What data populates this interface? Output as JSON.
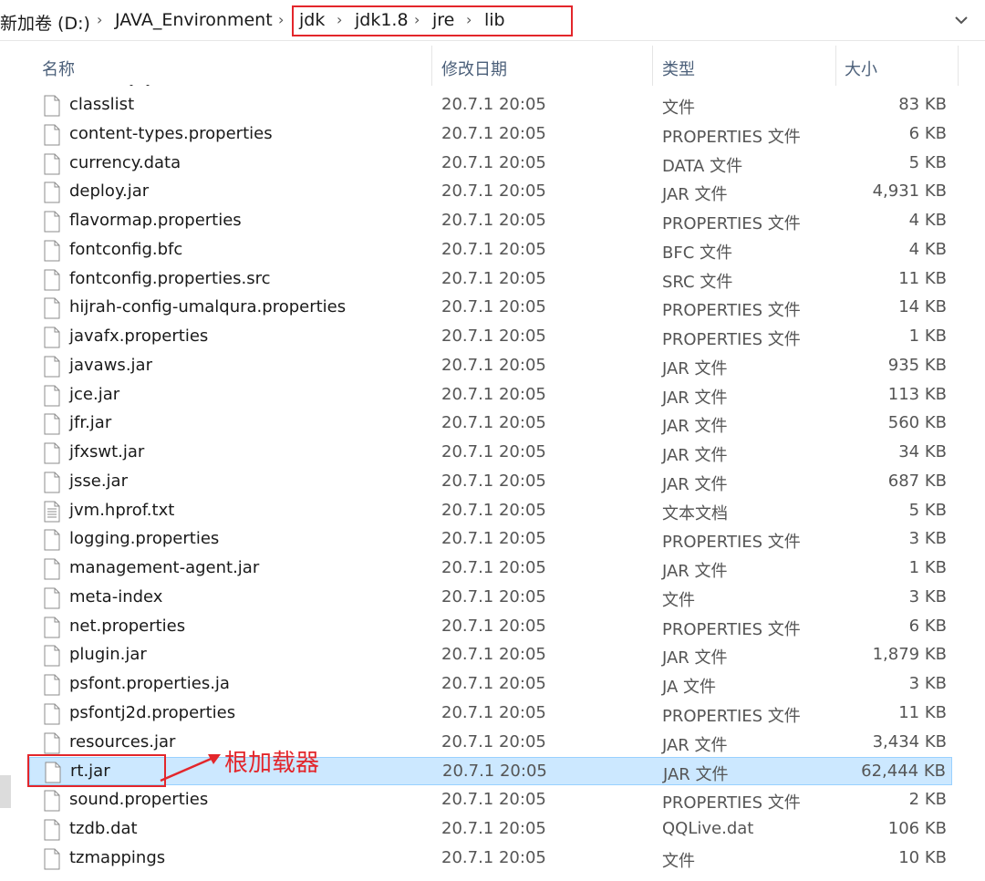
{
  "address": {
    "crumbs": [
      "新加卷 (D:)",
      "JAVA_Environment",
      "jdk",
      "jdk1.8",
      "jre",
      "lib"
    ],
    "highlight_color": "#e3262b"
  },
  "columns": {
    "name": "名称",
    "date": "修改日期",
    "type": "类型",
    "size": "大小"
  },
  "files": [
    {
      "name": "classlist",
      "date": "20.7.1 20:05",
      "type": "文件",
      "size": "83 KB"
    },
    {
      "name": "content-types.properties",
      "date": "20.7.1 20:05",
      "type": "PROPERTIES 文件",
      "size": "6 KB"
    },
    {
      "name": "currency.data",
      "date": "20.7.1 20:05",
      "type": "DATA 文件",
      "size": "5 KB"
    },
    {
      "name": "deploy.jar",
      "date": "20.7.1 20:05",
      "type": "JAR 文件",
      "size": "4,931 KB"
    },
    {
      "name": "flavormap.properties",
      "date": "20.7.1 20:05",
      "type": "PROPERTIES 文件",
      "size": "4 KB"
    },
    {
      "name": "fontconfig.bfc",
      "date": "20.7.1 20:05",
      "type": "BFC 文件",
      "size": "4 KB"
    },
    {
      "name": "fontconfig.properties.src",
      "date": "20.7.1 20:05",
      "type": "SRC 文件",
      "size": "11 KB"
    },
    {
      "name": "hijrah-config-umalqura.properties",
      "date": "20.7.1 20:05",
      "type": "PROPERTIES 文件",
      "size": "14 KB"
    },
    {
      "name": "javafx.properties",
      "date": "20.7.1 20:05",
      "type": "PROPERTIES 文件",
      "size": "1 KB"
    },
    {
      "name": "javaws.jar",
      "date": "20.7.1 20:05",
      "type": "JAR 文件",
      "size": "935 KB"
    },
    {
      "name": "jce.jar",
      "date": "20.7.1 20:05",
      "type": "JAR 文件",
      "size": "113 KB"
    },
    {
      "name": "jfr.jar",
      "date": "20.7.1 20:05",
      "type": "JAR 文件",
      "size": "560 KB"
    },
    {
      "name": "jfxswt.jar",
      "date": "20.7.1 20:05",
      "type": "JAR 文件",
      "size": "34 KB"
    },
    {
      "name": "jsse.jar",
      "date": "20.7.1 20:05",
      "type": "JAR 文件",
      "size": "687 KB"
    },
    {
      "name": "jvm.hprof.txt",
      "date": "20.7.1 20:05",
      "type": "文本文档",
      "size": "5 KB",
      "icon": "text-document-icon"
    },
    {
      "name": "logging.properties",
      "date": "20.7.1 20:05",
      "type": "PROPERTIES 文件",
      "size": "3 KB"
    },
    {
      "name": "management-agent.jar",
      "date": "20.7.1 20:05",
      "type": "JAR 文件",
      "size": "1 KB"
    },
    {
      "name": "meta-index",
      "date": "20.7.1 20:05",
      "type": "文件",
      "size": "3 KB"
    },
    {
      "name": "net.properties",
      "date": "20.7.1 20:05",
      "type": "PROPERTIES 文件",
      "size": "6 KB"
    },
    {
      "name": "plugin.jar",
      "date": "20.7.1 20:05",
      "type": "JAR 文件",
      "size": "1,879 KB"
    },
    {
      "name": "psfont.properties.ja",
      "date": "20.7.1 20:05",
      "type": "JA 文件",
      "size": "3 KB"
    },
    {
      "name": "psfontj2d.properties",
      "date": "20.7.1 20:05",
      "type": "PROPERTIES 文件",
      "size": "11 KB"
    },
    {
      "name": "resources.jar",
      "date": "20.7.1 20:05",
      "type": "JAR 文件",
      "size": "3,434 KB"
    },
    {
      "name": "rt.jar",
      "date": "20.7.1 20:05",
      "type": "JAR 文件",
      "size": "62,444 KB",
      "selected": true
    },
    {
      "name": "sound.properties",
      "date": "20.7.1 20:05",
      "type": "PROPERTIES 文件",
      "size": "2 KB"
    },
    {
      "name": "tzdb.dat",
      "date": "20.7.1 20:05",
      "type": "QQLive.dat",
      "size": "106 KB"
    },
    {
      "name": "tzmappings",
      "date": "20.7.1 20:05",
      "type": "文件",
      "size": "10 KB"
    }
  ],
  "annotation": {
    "label": "根加载器",
    "color": "#e3262b"
  },
  "colors": {
    "selected_bg": "#cce8ff",
    "selected_border": "#99d1ff",
    "header_text": "#4c607a"
  }
}
